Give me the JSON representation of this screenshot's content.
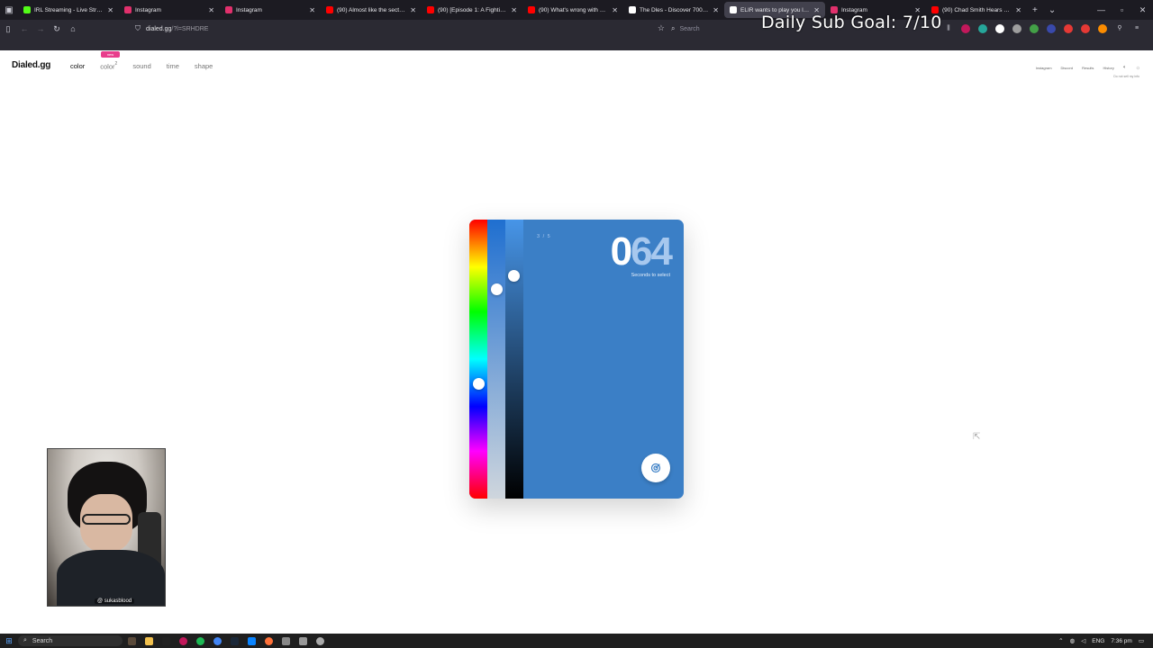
{
  "browser": {
    "tabs": [
      {
        "title": "IRL Streaming - Live Streams o",
        "color": "#53fc18"
      },
      {
        "title": "Instagram",
        "color": "#e1306c"
      },
      {
        "title": "Instagram",
        "color": "#e1306c"
      },
      {
        "title": "(90) Almost like the sect leader",
        "color": "#ff0000"
      },
      {
        "title": "(90) [Episode 1: A Fighting Cha",
        "color": "#ff0000"
      },
      {
        "title": "(90) What's wrong with my nam",
        "color": "#ff0000"
      },
      {
        "title": "The Dles - Discover 700+ Free",
        "color": "#ffffff"
      },
      {
        "title": "ELIR wants to play you live righ",
        "color": "#ffffff"
      },
      {
        "title": "Instagram",
        "color": "#e1306c"
      },
      {
        "title": "(90) Chad Smith Hears Bring M",
        "color": "#ff0000"
      }
    ],
    "active_tab_index": 7,
    "url_host": "dialed.gg",
    "url_path": "/?l=SRHDRE",
    "search_placeholder": "Search"
  },
  "stream_overlay": {
    "goal_text": "Daily Sub Goal: 7/10",
    "cam_tag": "@ sukasblood"
  },
  "site": {
    "logo": "Dialed.gg",
    "nav": {
      "color": "color",
      "color2": "color",
      "color2_sup": "2",
      "sound": "sound",
      "time": "time",
      "shape": "shape",
      "new_badge": "new"
    },
    "toplinks": [
      "Instagram",
      "Discord",
      "Results",
      "History"
    ],
    "do_not_sell": "Do not sell my info"
  },
  "game": {
    "round": "3 / 5",
    "timer_lead": "0",
    "timer_rest": "64",
    "timer_label": "Seconds to select",
    "card_color": "#3b7fc6",
    "hue_level": 0.59,
    "saturation_level": 0.25,
    "brightness_level": 0.2
  },
  "taskbar": {
    "search_label": "Search",
    "lang": "ENG",
    "time": "7:36 pm"
  }
}
